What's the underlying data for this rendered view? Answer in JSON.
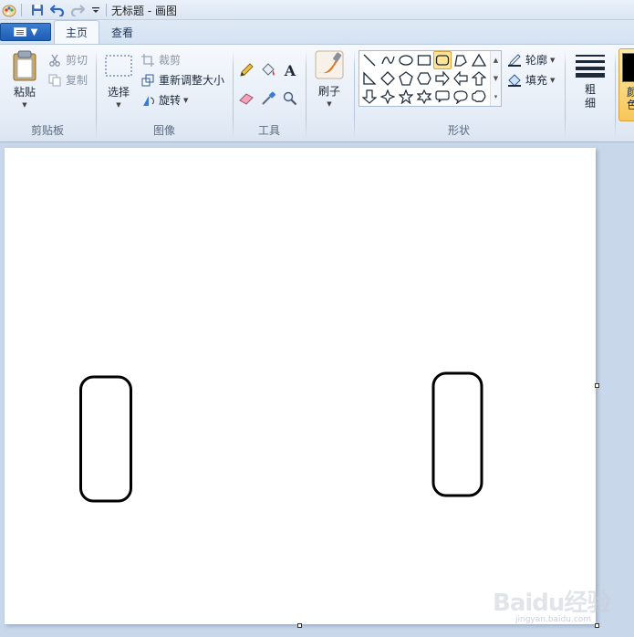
{
  "window": {
    "title": "无标题 - 画图"
  },
  "quick_access": {
    "icons": [
      "paint-app-icon",
      "save-icon",
      "undo-icon",
      "redo-icon",
      "customize-dropdown-icon"
    ]
  },
  "tabs": [
    {
      "label": "主页",
      "active": true
    },
    {
      "label": "查看",
      "active": false
    }
  ],
  "ribbon": {
    "clipboard": {
      "label": "剪贴板",
      "paste": "粘贴",
      "cut": "剪切",
      "copy": "复制"
    },
    "image": {
      "label": "图像",
      "select": "选择",
      "crop": "裁剪",
      "resize": "重新调整大小",
      "rotate": "旋转"
    },
    "tools": {
      "label": "工具",
      "items": [
        "pencil-icon",
        "fill-icon",
        "text-icon",
        "eraser-icon",
        "color-picker-icon",
        "magnifier-icon"
      ]
    },
    "brushes": {
      "label": "刷子"
    },
    "shapes": {
      "label": "形状",
      "outline": "轮廓",
      "fill": "填充",
      "selected_shape": "rounded-rectangle"
    },
    "size": {
      "label": "粗\n细"
    },
    "colors": {
      "color1_label": "颜\n色",
      "color1": "#000000"
    }
  },
  "watermark": {
    "text": "Baidu经验",
    "url": "jingyan.baidu.com"
  }
}
